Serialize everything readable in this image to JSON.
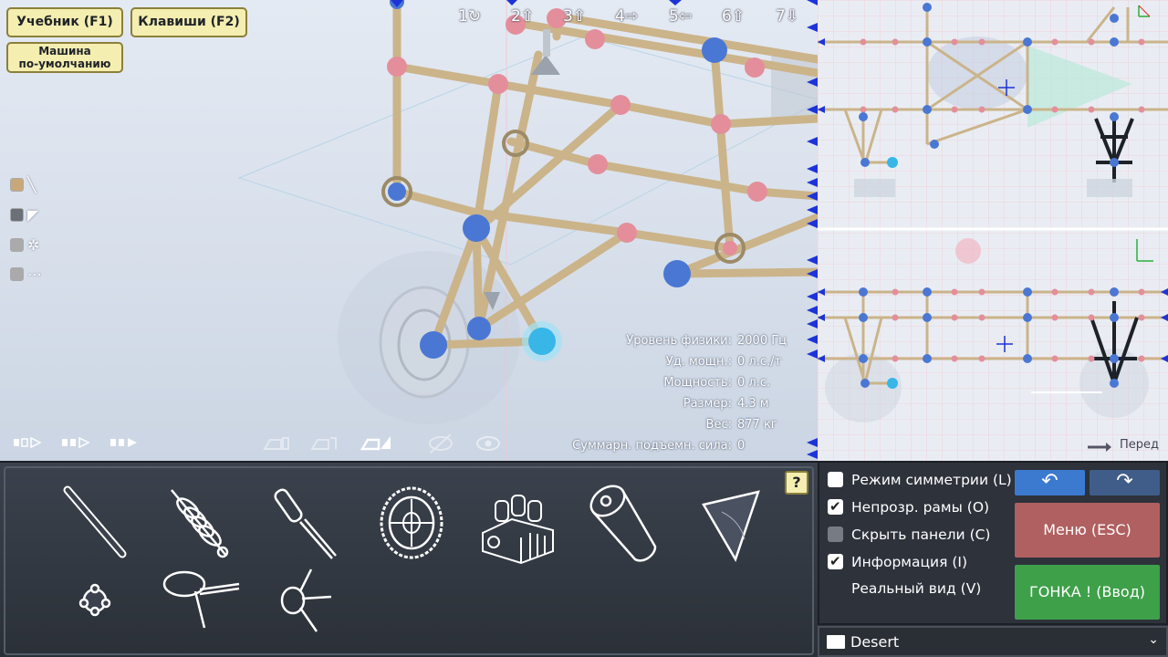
{
  "toolbar": {
    "tutorial_label": "Учебник (F1)",
    "keys_label": "Клавиши (F2)",
    "default_car_line1": "Машина",
    "default_car_line2": "по-умолчанию"
  },
  "camera_views": [
    {
      "num": "1",
      "icon": "↻"
    },
    {
      "num": "2",
      "icon": "⇧"
    },
    {
      "num": "3",
      "icon": "⇧"
    },
    {
      "num": "4",
      "icon": "⇨"
    },
    {
      "num": "5",
      "icon": "⇦"
    },
    {
      "num": "6",
      "icon": "⇧"
    },
    {
      "num": "7",
      "icon": "⇩"
    }
  ],
  "layers": [
    {
      "name": "beam-layer",
      "color": "#c8a878",
      "icon": "╲"
    },
    {
      "name": "wing-layer",
      "color": "#6a6f78",
      "icon": "◤"
    },
    {
      "name": "wheel-layer",
      "color": "#aaaaaa",
      "icon": "✲"
    },
    {
      "name": "other-layer",
      "color": "#aaaaaa",
      "icon": "⋯"
    }
  ],
  "stats": [
    {
      "label": "Уровень физики:",
      "value": "2000 Гц"
    },
    {
      "label": "Уд. мощн.:",
      "value": "0 л.с./т"
    },
    {
      "label": "Мощность:",
      "value": "0 л.с."
    },
    {
      "label": "Размер:",
      "value": "4.3 м"
    },
    {
      "label": "Вес:",
      "value": "877 кг"
    },
    {
      "label": "Суммарн. подъемн. сила:",
      "value": "0"
    }
  ],
  "blueprint": {
    "forward_label": "Перед"
  },
  "parts_panel": {
    "help_label": "?"
  },
  "options": [
    {
      "label": "Режим симметрии (L)",
      "state": "unchecked"
    },
    {
      "label": "Непрозр. рамы (O)",
      "state": "checked"
    },
    {
      "label": "Скрыть панели (C)",
      "state": "disabled"
    },
    {
      "label": "Информация (I)",
      "state": "checked"
    },
    {
      "label": "Реальный вид (V)",
      "state": "none"
    }
  ],
  "actions": {
    "undo_icon": "↶",
    "redo_icon": "↷",
    "menu_label": "Меню (ESC)",
    "race_label": "ГОНКА ! (Ввод)"
  },
  "terrain": {
    "selected": "Desert",
    "arrow": "⌄"
  },
  "colors": {
    "yellow_button": "#f4eeb0",
    "menu_button": "#b06060",
    "race_button": "#3fa04a",
    "undo_button": "#3c7ad0"
  }
}
